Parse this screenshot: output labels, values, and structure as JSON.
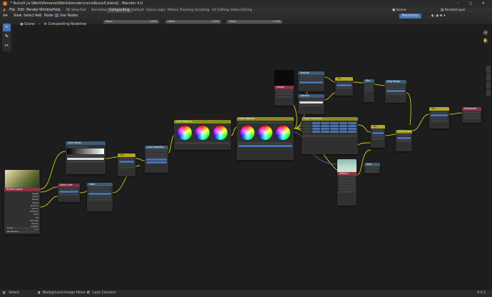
{
  "window": {
    "title": "* Ruins5 [e:\\Work\\Personal\\Work\\blender\\ruins\\Ruins5.blend] - Blender 4.0"
  },
  "menu": [
    "File",
    "Edit",
    "Render",
    "Window",
    "Help"
  ],
  "editor_menu": [
    "View",
    "Select",
    "Add",
    "Node"
  ],
  "use_nodes_label": "Use Nodes",
  "workspaces": [
    "3D View Full",
    "Animation",
    "Compositing",
    "Default",
    "Game Logic",
    "Motion Tracking",
    "Scripting",
    "UV Editing",
    "Video Editing"
  ],
  "active_workspace": "Compositing",
  "scene_label": "Scene",
  "view_layer_label": "RenderLayer",
  "backdrop_label": "Backdrop",
  "header_fields": [
    {
      "label": "Zoom",
      "value": "1.000"
    },
    {
      "label": "Offset",
      "value": "0.000"
    },
    {
      "label": "Offset",
      "value": "0.000"
    }
  ],
  "breadcrumb": {
    "scene": "Scene",
    "tree": "Compositing Nodetree"
  },
  "status": {
    "select": "Select",
    "move": "Background Image Move",
    "pan": "Lazy Connect",
    "version": "4.0.2"
  },
  "nodes": {
    "render_layers": {
      "title": "Render Layers",
      "scene": "Scene",
      "layer": "RenderLayer",
      "outputs": [
        "Image",
        "Alpha",
        "Depth",
        "Noise",
        "Normal",
        "Vector",
        "Position",
        "Emit",
        "AO",
        "Shadow",
        "Glossy",
        "Diffuse",
        "Mist"
      ]
    },
    "color_ramp": "Color Ramp",
    "alpha_over": "Alpha Over",
    "glare": "Glare",
    "lens_distortion": "Lens Distortion",
    "color_balance": "Color Balance",
    "color_balance_2": "Color Balance",
    "color_correction": "Color Correction",
    "viewer": "Viewer",
    "mix": "Mix",
    "rgb_curves": "RGB Curves",
    "hue_sat": "Hue/Sat",
    "blur": "Blur",
    "composite": "Composite",
    "split": "Split",
    "map_range": "Map Range",
    "defocus": "Defocus",
    "gamma": "Gamma"
  }
}
